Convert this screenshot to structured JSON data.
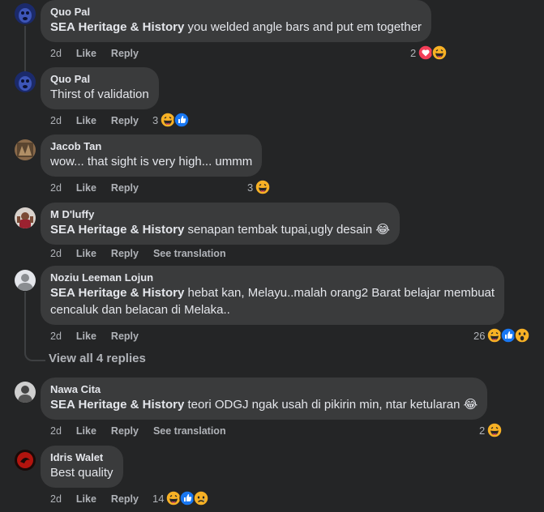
{
  "comments": [
    {
      "author": "Quo Pal",
      "tag": "SEA Heritage & History",
      "text_line1": " you welded angle bars and put em together",
      "text_line2": "",
      "time": "2d",
      "like": "Like",
      "reply": "Reply",
      "translation": "",
      "reaction_count": "2",
      "reactions": [
        "love",
        "haha"
      ]
    },
    {
      "author": "Quo Pal",
      "tag": "",
      "text_line1": "Thirst of validation",
      "text_line2": "",
      "time": "2d",
      "like": "Like",
      "reply": "Reply",
      "translation": "",
      "reaction_count": "3",
      "reactions": [
        "haha",
        "like"
      ]
    },
    {
      "author": "Jacob Tan",
      "tag": "",
      "text_line1": "wow... that sight is very high... ummm",
      "text_line2": "",
      "time": "2d",
      "like": "Like",
      "reply": "Reply",
      "translation": "",
      "reaction_count": "3",
      "reactions": [
        "haha"
      ]
    },
    {
      "author": "M D'luffy",
      "tag": "SEA Heritage & History",
      "text_line1": " senapan tembak tupai,ugly desain 😂",
      "text_line2": "",
      "time": "2d",
      "like": "Like",
      "reply": "Reply",
      "translation": "See translation",
      "reaction_count": "",
      "reactions": []
    },
    {
      "author": "Noziu Leeman Lojun",
      "tag": "SEA Heritage & History",
      "text_line1": " hebat kan, Melayu..malah orang2 Barat belajar membuat",
      "text_line2": "cencaluk dan belacan di Melaka..",
      "time": "2d",
      "like": "Like",
      "reply": "Reply",
      "translation": "",
      "reaction_count": "26",
      "reactions": [
        "haha",
        "like",
        "wow"
      ]
    },
    {
      "author": "Nawa Cita",
      "tag": "SEA Heritage & History",
      "text_line1": " teori ODGJ ngak usah di pikirin min, ntar ketularan 😂",
      "text_line2": "",
      "time": "2d",
      "like": "Like",
      "reply": "Reply",
      "translation": "See translation",
      "reaction_count": "2",
      "reactions": [
        "haha"
      ]
    },
    {
      "author": "Idris Walet",
      "tag": "",
      "text_line1": "Best quality",
      "text_line2": "",
      "time": "2d",
      "like": "Like",
      "reply": "Reply",
      "translation": "",
      "reaction_count": "14",
      "reactions": [
        "haha",
        "like",
        "sad"
      ]
    }
  ],
  "view_replies": "View all 4 replies",
  "colors": {
    "background": "#242526",
    "bubble": "#3a3b3c",
    "text": "#e4e6eb",
    "secondary": "#b0b3b8",
    "like_blue": "#1877f2",
    "love_red": "#f33e58",
    "haha_yellow": "#f7b125"
  }
}
